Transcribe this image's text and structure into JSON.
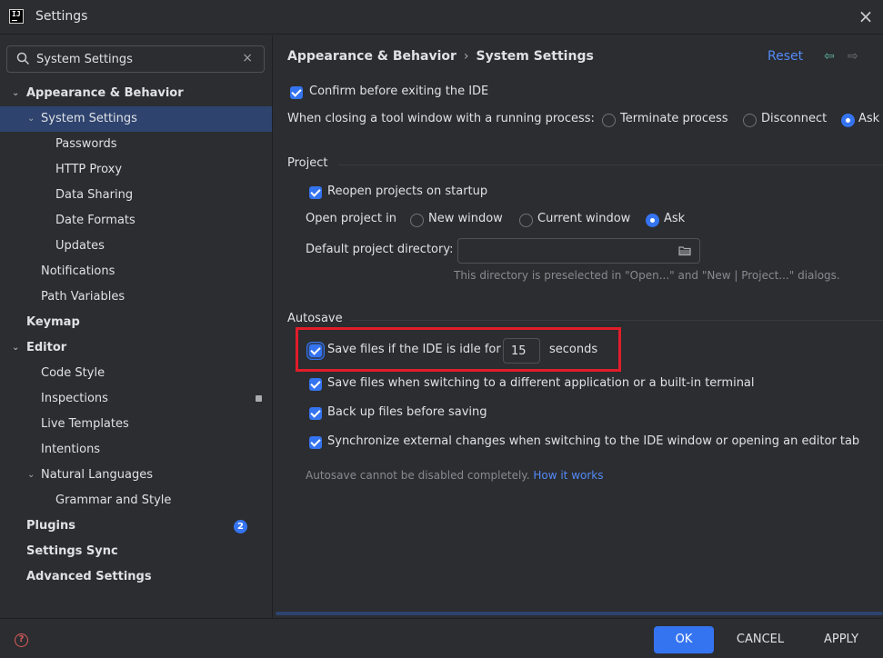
{
  "window": {
    "title": "Settings",
    "logo_text": "IJ"
  },
  "search": {
    "value": "System Settings",
    "clear_glyph": "×"
  },
  "tree": {
    "items": [
      {
        "label": "Appearance & Behavior",
        "expanded": true
      },
      {
        "label": "System Settings",
        "selected": true,
        "expanded": true
      },
      {
        "label": "Passwords"
      },
      {
        "label": "HTTP Proxy"
      },
      {
        "label": "Data Sharing"
      },
      {
        "label": "Date Formats"
      },
      {
        "label": "Updates"
      },
      {
        "label": "Notifications"
      },
      {
        "label": "Path Variables"
      },
      {
        "label": "Keymap"
      },
      {
        "label": "Editor",
        "expanded": true
      },
      {
        "label": "Code Style"
      },
      {
        "label": "Inspections"
      },
      {
        "label": "Live Templates"
      },
      {
        "label": "Intentions"
      },
      {
        "label": "Natural Languages",
        "expanded": true
      },
      {
        "label": "Grammar and Style"
      },
      {
        "label": "Plugins",
        "badge": "2"
      },
      {
        "label": "Settings Sync"
      },
      {
        "label": "Advanced Settings"
      }
    ]
  },
  "header": {
    "crumb_parent": "Appearance & Behavior",
    "crumb_sep": "›",
    "crumb_current": "System Settings",
    "reset_label": "Reset",
    "back_glyph": "⇦",
    "forward_glyph": "⇨"
  },
  "general": {
    "confirm_exit_label": "Confirm before exiting the IDE",
    "confirm_exit_checked": true,
    "closing_tool_label": "When closing a tool window with a running process:",
    "closing_options": [
      "Terminate process",
      "Disconnect",
      "Ask"
    ],
    "closing_selected": "Ask"
  },
  "project": {
    "section_title": "Project",
    "reopen_label": "Reopen projects on startup",
    "reopen_checked": true,
    "open_in_label": "Open project in",
    "open_options": [
      "New window",
      "Current window",
      "Ask"
    ],
    "open_selected": "Ask",
    "default_dir_label": "Default project directory:",
    "default_dir_value": "",
    "default_dir_hint": "This directory is preselected in \"Open...\" and \"New | Project...\" dialogs."
  },
  "autosave": {
    "section_title": "Autosave",
    "idle_label": "Save files if the IDE is idle for",
    "idle_checked": true,
    "idle_seconds": "15",
    "seconds_label": "seconds",
    "switch_app_label": "Save files when switching to a different application or a built-in terminal",
    "switch_app_checked": true,
    "backup_label": "Back up files before saving",
    "backup_checked": true,
    "sync_label": "Synchronize external changes when switching to the IDE window or opening an editor tab",
    "sync_checked": true,
    "note_text": "Autosave cannot be disabled completely.",
    "note_link": "How it works"
  },
  "footer": {
    "help_glyph": "?",
    "ok_label": "OK",
    "cancel_label": "CANCEL",
    "apply_label": "APPLY"
  },
  "colors": {
    "accent": "#3574f0",
    "selection": "#2e436e",
    "highlight_annotation": "#e11d2a",
    "link": "#548af7"
  }
}
